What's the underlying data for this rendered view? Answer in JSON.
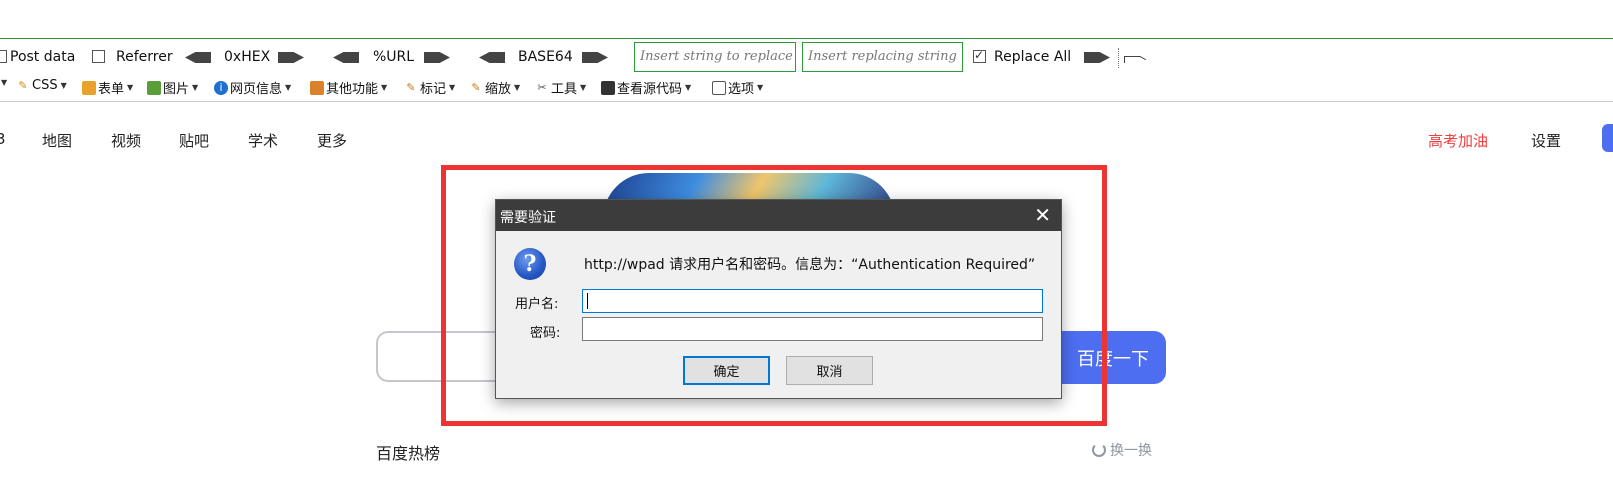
{
  "toolbar": {
    "post_data_label": "Post data",
    "referrer_label": "Referrer",
    "hex_label": "0xHEX",
    "url_label": "%URL",
    "base64_label": "BASE64",
    "insert_placeholder": "Insert string to replace",
    "replacing_placeholder": "Insert replacing string",
    "replace_all_label": "Replace All"
  },
  "menu": {
    "css": "CSS",
    "form": "表单",
    "images": "图片",
    "page_info": "网页信息",
    "other": "其他功能",
    "mark": "标记",
    "zoom": "缩放",
    "tools": "工具",
    "view_source": "查看源代码",
    "options": "选项"
  },
  "nav": {
    "partial": "3",
    "map": "地图",
    "video": "视频",
    "tieba": "贴吧",
    "scholar": "学术",
    "more": "更多",
    "gaokao": "高考加油",
    "settings": "设置"
  },
  "search": {
    "button": "百度一下",
    "hot_title": "百度热榜",
    "refresh": "换一换"
  },
  "dialog": {
    "title": "需要验证",
    "message": "http://wpad 请求用户名和密码。信息为：“Authentication Required”",
    "username_label": "用户名:",
    "password_label": "密码:",
    "ok": "确定",
    "cancel": "取消"
  },
  "colors": {
    "baidu_blue": "#4e6ef2",
    "annotation_red": "#ee3333",
    "toolbar_green": "#2c9b3a"
  }
}
